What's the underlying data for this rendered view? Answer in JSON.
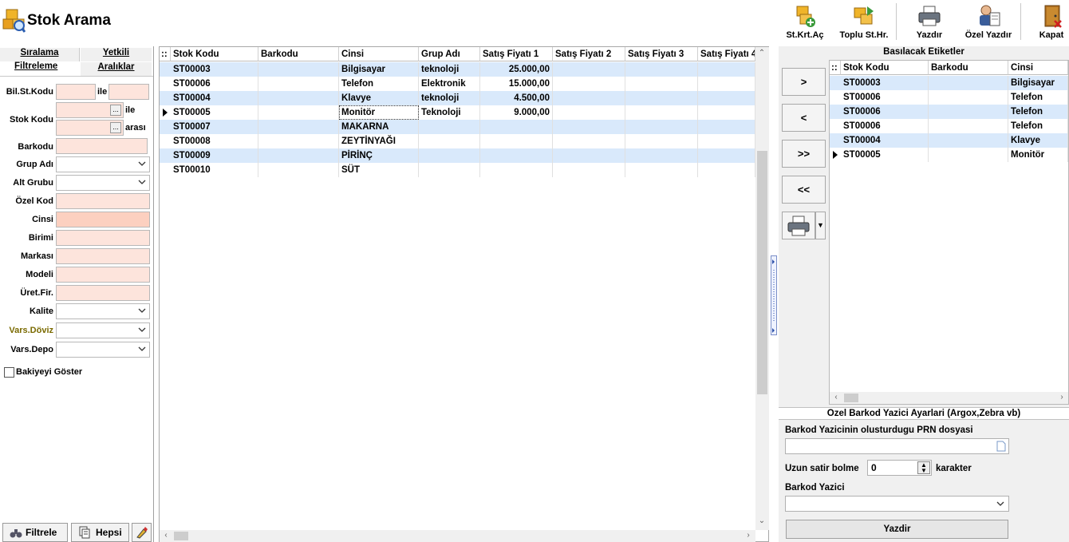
{
  "app": {
    "title": "Stok Arama"
  },
  "toolbar": {
    "items": [
      {
        "label": "St.Krt.Aç"
      },
      {
        "label": "Toplu St.Hr."
      },
      {
        "label": "Yazdır"
      },
      {
        "label": "Özel Yazdır"
      },
      {
        "label": "Kapat"
      }
    ]
  },
  "left": {
    "tabs": {
      "siralama": "Sıralama",
      "yetkili": "Yetkili",
      "filtreleme": "Filtreleme",
      "araliklar": "Aralıklar"
    },
    "fields": {
      "bil_st_kodu": "Bil.St.Kodu",
      "ile1": "ile",
      "stok_kodu": "Stok Kodu",
      "ile2": "ile",
      "arasi": "arası",
      "barkodu": "Barkodu",
      "grup_adi": "Grup Adı",
      "alt_grubu": "Alt Grubu",
      "ozel_kod": "Özel Kod",
      "cinsi": "Cinsi",
      "birimi": "Birimi",
      "markasi": "Markası",
      "modeli": "Modeli",
      "uret_fir": "Üret.Fir.",
      "kalite": "Kalite",
      "vars_doviz": "Vars.Döviz",
      "vars_depo": "Vars.Depo"
    },
    "ellipsis": "...",
    "bakiye": "Bakiyeyi Göster",
    "buttons": {
      "filtrele": "Filtrele",
      "hepsi": "Hepsi"
    },
    "vars_doviz_color": "#7a6a00"
  },
  "grid": {
    "columns": [
      "Stok Kodu",
      "Barkodu",
      "Cinsi",
      "Grup Adı",
      "Satış Fiyatı 1",
      "Satış Fiyatı 2",
      "Satış Fiyatı 3",
      "Satış Fiyatı 4"
    ],
    "rows": [
      {
        "stok_kodu": "ST00003",
        "barkodu": "",
        "cinsi": "Bilgisayar",
        "grup": "teknoloji",
        "f1": "25.000,00"
      },
      {
        "stok_kodu": "ST00006",
        "barkodu": "",
        "cinsi": "Telefon",
        "grup": "Elektronik",
        "f1": "15.000,00"
      },
      {
        "stok_kodu": "ST00004",
        "barkodu": "",
        "cinsi": "Klavye",
        "grup": "teknoloji",
        "f1": "4.500,00"
      },
      {
        "stok_kodu": "ST00005",
        "barkodu": "",
        "cinsi": "Monitör",
        "grup": "Teknoloji",
        "f1": "9.000,00"
      },
      {
        "stok_kodu": "ST00007",
        "barkodu": "",
        "cinsi": "MAKARNA",
        "grup": "",
        "f1": ""
      },
      {
        "stok_kodu": "ST00008",
        "barkodu": "",
        "cinsi": "ZEYTİNYAĞI",
        "grup": "",
        "f1": ""
      },
      {
        "stok_kodu": "ST00009",
        "barkodu": "",
        "cinsi": "PİRİNÇ",
        "grup": "",
        "f1": ""
      },
      {
        "stok_kodu": "ST00010",
        "barkodu": "",
        "cinsi": "SÜT",
        "grup": "",
        "f1": ""
      }
    ],
    "row_selector": "::"
  },
  "right": {
    "title": "Basılacak Etiketler",
    "move_buttons": [
      ">",
      "<",
      ">>",
      "<<"
    ],
    "columns": [
      "Stok Kodu",
      "Barkodu",
      "Cinsi"
    ],
    "rows": [
      {
        "stok_kodu": "ST00003",
        "barkodu": "",
        "cinsi": "Bilgisayar"
      },
      {
        "stok_kodu": "ST00006",
        "barkodu": "",
        "cinsi": "Telefon"
      },
      {
        "stok_kodu": "ST00006",
        "barkodu": "",
        "cinsi": "Telefon"
      },
      {
        "stok_kodu": "ST00006",
        "barkodu": "",
        "cinsi": "Telefon"
      },
      {
        "stok_kodu": "ST00004",
        "barkodu": "",
        "cinsi": "Klavye"
      },
      {
        "stok_kodu": "ST00005",
        "barkodu": "",
        "cinsi": "Monitör"
      }
    ],
    "settings": {
      "title": "Ozel Barkod Yazici Ayarlari (Argox,Zebra vb)",
      "prn_label": "Barkod Yazicinin olusturdugu PRN dosyasi",
      "prn_value": "",
      "uzun_label": "Uzun satir bolme",
      "uzun_value": "0",
      "karakter": "karakter",
      "yazici_label": "Barkod Yazici",
      "yazici_value": "",
      "yazdir": "Yazdir"
    }
  },
  "colors": {
    "row_alt": "#d9e9fb",
    "input_bg": "#fde4dc",
    "panel_bg": "#f0f0f0"
  }
}
